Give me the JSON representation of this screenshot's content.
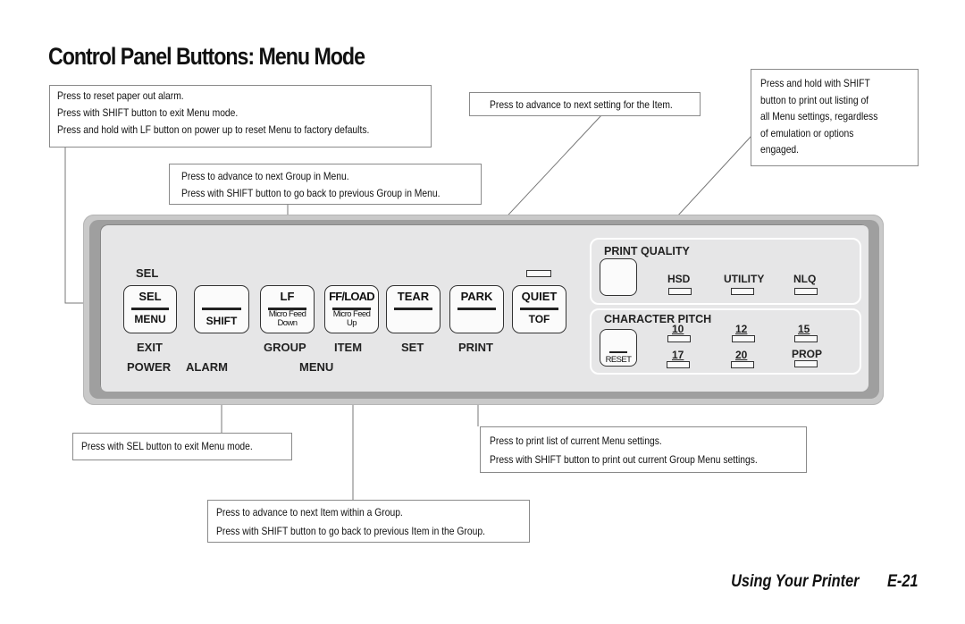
{
  "page": {
    "title": "Control Panel Buttons: Menu Mode",
    "footer": {
      "section": "Using Your Printer",
      "page_number": "E-21"
    }
  },
  "callouts": {
    "sel": [
      "Press to reset paper out alarm.",
      "Press with SHIFT button to exit Menu mode.",
      "Press and hold with LF button on power up to reset Menu to factory defaults."
    ],
    "lf": [
      "Press to advance to next Group in Menu.",
      "Press with  SHIFT button to go back to previous Group in Menu."
    ],
    "tear": [
      "Press to advance to next setting for the Item."
    ],
    "print_quality": [
      "Press and hold with SHIFT",
      "button to print out listing of",
      "all Menu settings, regardless",
      "of emulation or options",
      "engaged."
    ],
    "shift": [
      "Press with SEL button to exit Menu mode."
    ],
    "park": [
      "Press to print list of current Menu settings.",
      "Press with SHIFT button to print out current Group Menu settings."
    ],
    "ffload": [
      "Press to advance to next Item within a Group.",
      "Press with SHIFT button to go back to previous Item in the Group."
    ]
  },
  "panel": {
    "sel_indicator_label": "SEL",
    "buttons": {
      "sel": {
        "top": "SEL",
        "bottom": "MENU",
        "below": "EXIT"
      },
      "shift": {
        "top": "",
        "bottom": "SHIFT"
      },
      "lf": {
        "top": "LF",
        "bottom_line1": "Micro Feed",
        "bottom_line2": "Down",
        "below": "GROUP"
      },
      "ffload": {
        "top": "FF/LOAD",
        "bottom_line1": "Micro Feed",
        "bottom_line2": "Up",
        "below": "ITEM"
      },
      "tear": {
        "top": "TEAR",
        "below": "SET"
      },
      "park": {
        "top": "PARK",
        "below": "PRINT"
      },
      "quiet": {
        "top": "QUIET",
        "bottom": "TOF"
      }
    },
    "row_labels": {
      "power": "POWER",
      "alarm": "ALARM",
      "menu": "MENU"
    },
    "print_quality": {
      "title": "PRINT QUALITY",
      "leds": [
        "HSD",
        "UTILITY",
        "NLQ"
      ]
    },
    "character_pitch": {
      "title": "CHARACTER PITCH",
      "reset_label": "RESET",
      "leds_row1": [
        "10",
        "12",
        "15"
      ],
      "leds_row2": [
        "17",
        "20",
        "PROP"
      ]
    }
  }
}
